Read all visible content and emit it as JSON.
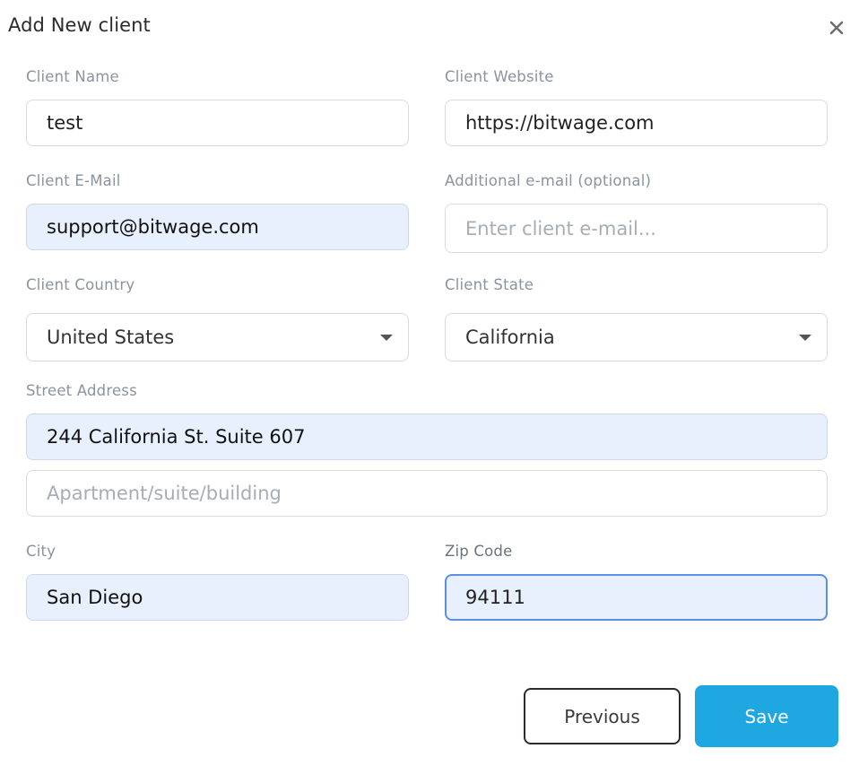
{
  "dialog": {
    "title": "Add New client",
    "close_icon": "close-icon"
  },
  "form": {
    "client_name": {
      "label": "Client Name",
      "value": "test"
    },
    "client_website": {
      "label": "Client Website",
      "value": "https://bitwage.com"
    },
    "client_email": {
      "label": "Client E-Mail",
      "value": "support@bitwage.com"
    },
    "additional_email": {
      "label": "Additional e-mail (optional)",
      "value": "",
      "placeholder": "Enter client e-mail..."
    },
    "client_country": {
      "label": "Client Country",
      "value": "United States"
    },
    "client_state": {
      "label": "Client State",
      "value": "California"
    },
    "street_address": {
      "label": "Street Address",
      "value": "244 California St. Suite 607"
    },
    "address_line2": {
      "value": "",
      "placeholder": "Apartment/suite/building"
    },
    "city": {
      "label": "City",
      "value": "San Diego"
    },
    "zip_code": {
      "label": "Zip Code",
      "value": "94111"
    }
  },
  "actions": {
    "previous_label": "Previous",
    "save_label": "Save"
  },
  "colors": {
    "accent": "#1ea7e1",
    "autofill_bg": "#e9f0fd",
    "focus_border": "#5b8fe4"
  }
}
